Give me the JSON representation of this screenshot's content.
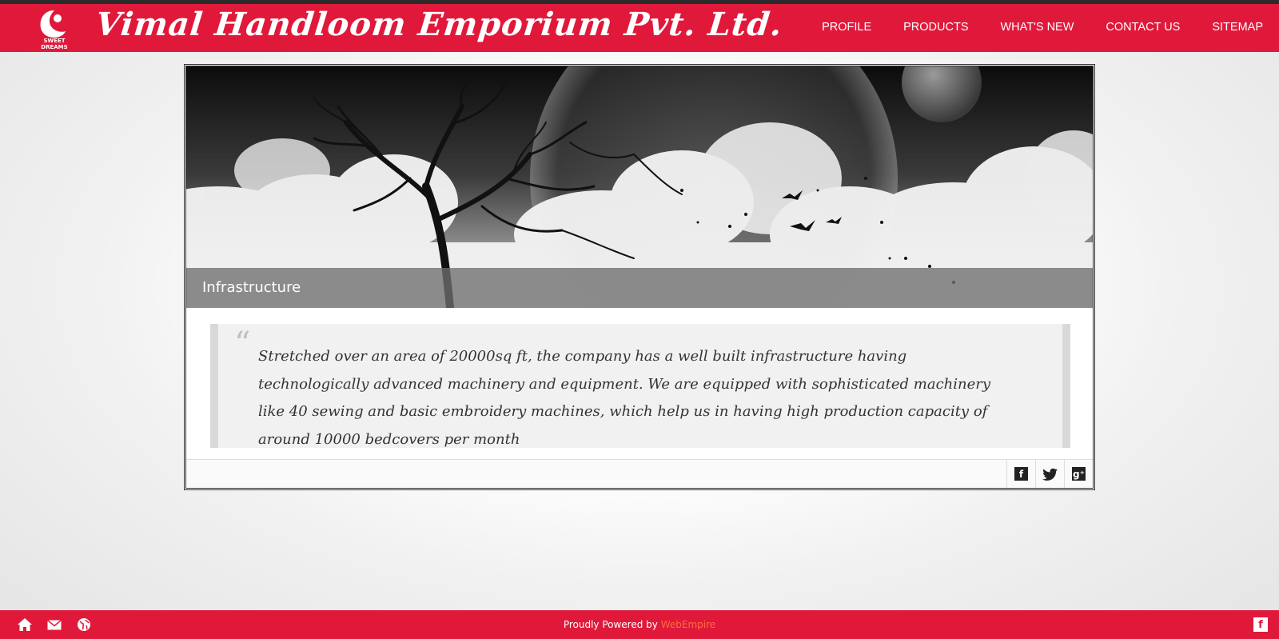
{
  "header": {
    "logo_text": "SWEET DREAMS",
    "title": "Vimal Handloom Emporium Pvt. Ltd.",
    "nav": [
      "PROFILE",
      "PRODUCTS",
      "WHAT'S NEW",
      "CONTACT US",
      "SITEMAP"
    ]
  },
  "card": {
    "caption": "Infrastructure",
    "quote_mark": "“",
    "quote": "Stretched over an area of 20000sq ft, the company has a well built infrastructure having technologically advanced machinery and equipment. We are equipped with sophisticated machinery like 40 sewing and basic embroidery machines, which help us in having high production capacity of around 10000 bedcovers per month",
    "share_icons": [
      "facebook-icon",
      "twitter-icon",
      "google-plus-icon"
    ]
  },
  "footer": {
    "powered_prefix": "Proudly Powered by",
    "powered_brand": "WebEmpire",
    "icons": [
      "home-icon",
      "mail-icon",
      "globe-icon"
    ],
    "fb_label": "f"
  },
  "colors": {
    "brand_red": "#e0193b",
    "topline": "#2b2b2b",
    "powered_brand": "#ff6a3d"
  }
}
